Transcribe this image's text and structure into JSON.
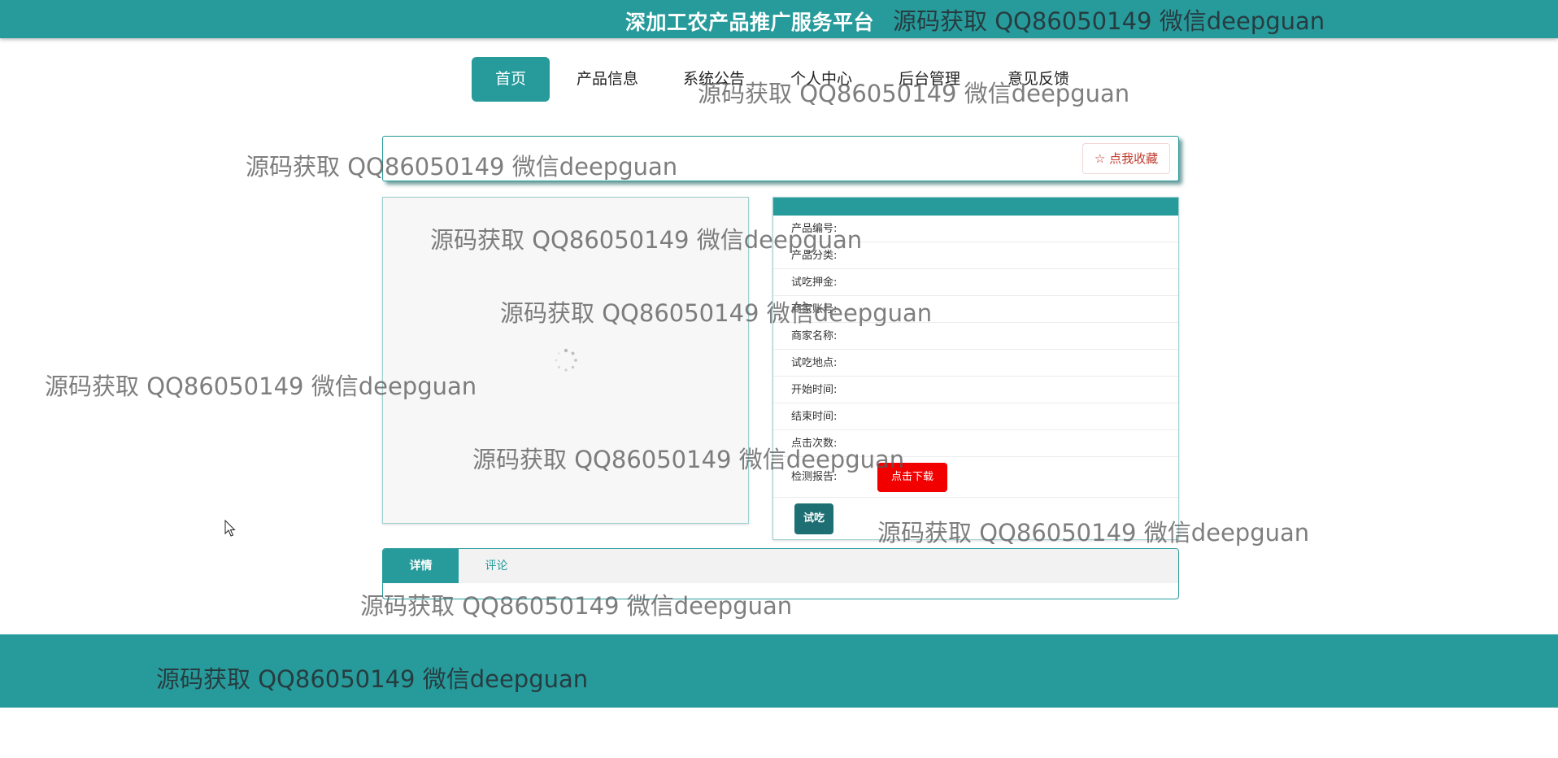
{
  "header": {
    "site_title": "深加工农产品推广服务平台"
  },
  "watermark_text": "源码获取 QQ86050149 微信deepguan",
  "nav": {
    "items": [
      {
        "label": "首页",
        "active": true
      },
      {
        "label": "产品信息",
        "active": false
      },
      {
        "label": "系统公告",
        "active": false
      },
      {
        "label": "个人中心",
        "active": false
      },
      {
        "label": "后台管理",
        "active": false
      },
      {
        "label": "意见反馈",
        "active": false
      }
    ]
  },
  "favorite": {
    "button_label": "☆ 点我收藏"
  },
  "product_info": {
    "fields": [
      "产品编号:",
      "产品分类:",
      "试吃押金:",
      "商家账号:",
      "商家名称:",
      "试吃地点:",
      "开始时间:",
      "结束时间:",
      "点击次数:"
    ],
    "report_label": "检测报告:",
    "download_button": "点击下载",
    "try_button": "试吃"
  },
  "tabs": {
    "items": [
      "详情",
      "评论"
    ],
    "active_index": 0
  },
  "colors": {
    "primary": "#279b9b",
    "download_button": "#f20000",
    "try_button": "#1e6f73",
    "favorite_text": "#c0392b"
  },
  "icons": {
    "loading": "loading-spinner-icon",
    "favorite_star": "star-icon",
    "mouse_cursor": "mouse-pointer-icon"
  }
}
